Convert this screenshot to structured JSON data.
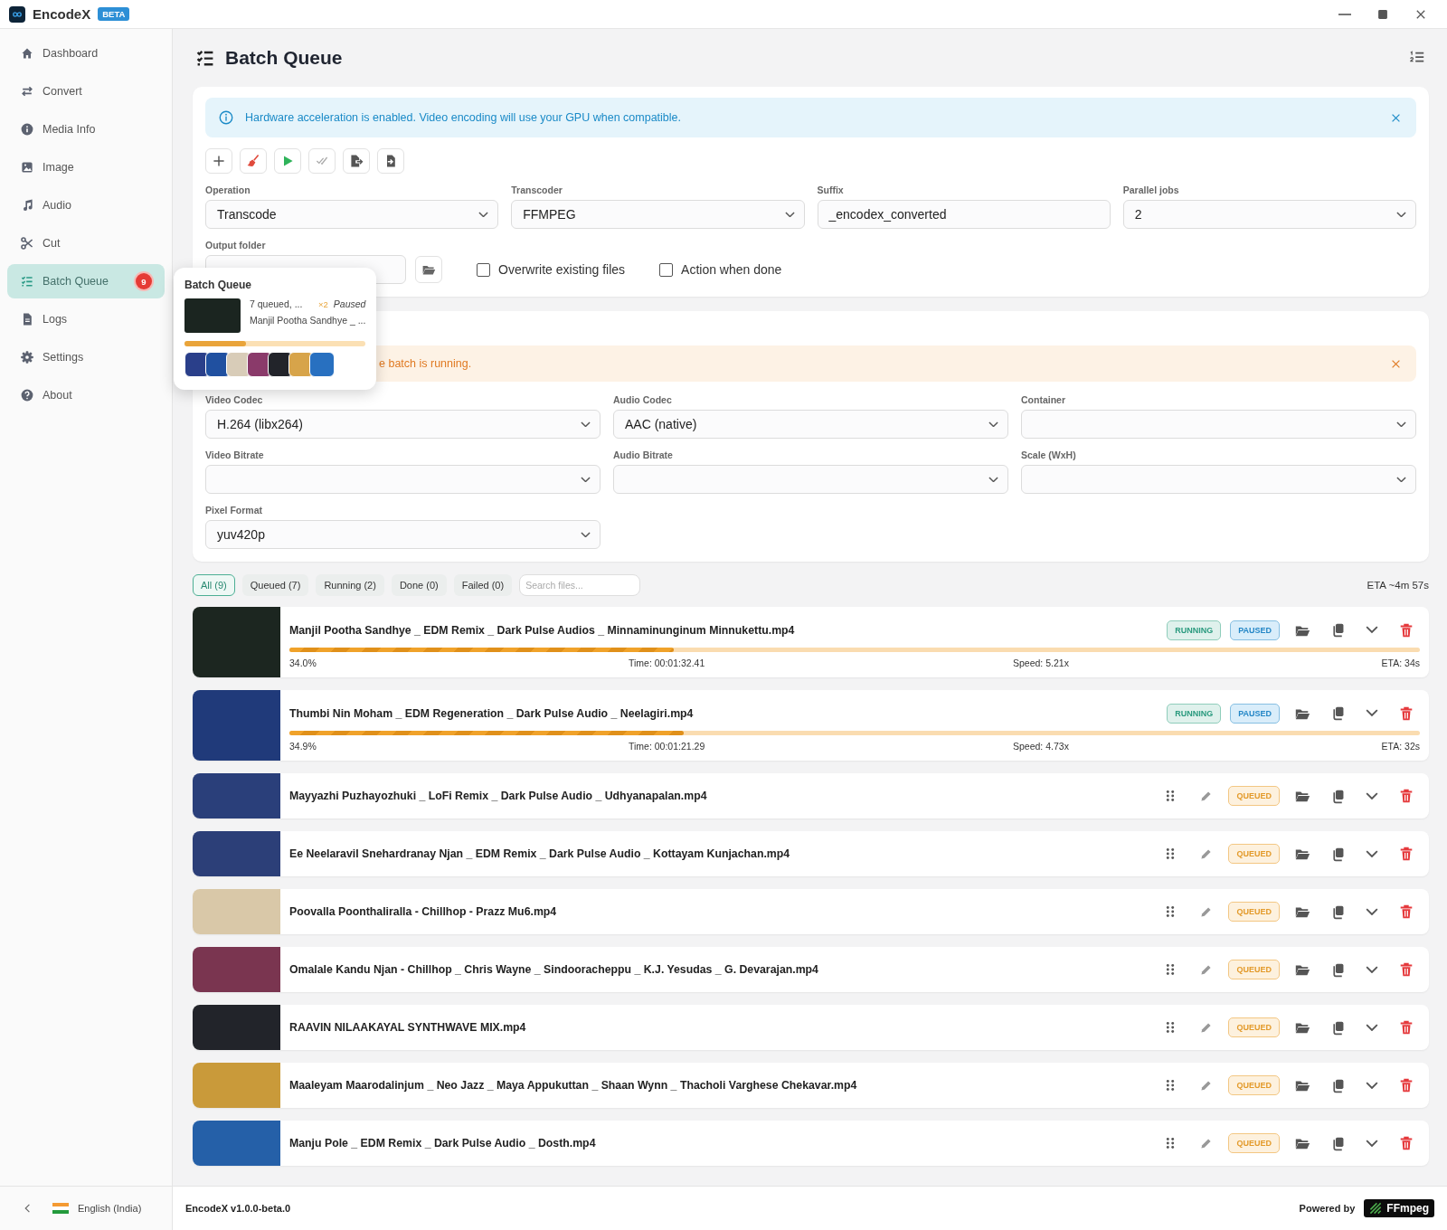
{
  "window": {
    "app_name": "EncodeX",
    "badge": "BETA"
  },
  "sidebar": {
    "items": [
      {
        "label": "Dashboard",
        "selected": false
      },
      {
        "label": "Convert",
        "selected": false
      },
      {
        "label": "Media Info",
        "selected": false
      },
      {
        "label": "Image",
        "selected": false
      },
      {
        "label": "Audio",
        "selected": false
      },
      {
        "label": "Cut",
        "selected": false
      },
      {
        "label": "Batch Queue",
        "selected": true,
        "badge": "9"
      },
      {
        "label": "Logs",
        "selected": false
      },
      {
        "label": "Settings",
        "selected": false
      },
      {
        "label": "About",
        "selected": false
      }
    ],
    "language": "English (India)"
  },
  "popover": {
    "title": "Batch Queue",
    "summary": "7 queued, ...",
    "multiplier": "×2",
    "state": "Paused",
    "current_file": "Manjil Pootha Sandhye _ ...",
    "level": 0.34
  },
  "page": {
    "title": "Batch Queue"
  },
  "info_banner": {
    "text": "Hardware acceleration is enabled. Video encoding will use your GPU when compatible."
  },
  "settings": {
    "fields": [
      {
        "label": "Operation",
        "kind": "select",
        "value": "Transcode"
      },
      {
        "label": "Transcoder",
        "kind": "select",
        "value": "FFMPEG"
      },
      {
        "label": "Suffix",
        "kind": "text",
        "value": "_encodex_converted"
      },
      {
        "label": "Parallel jobs",
        "kind": "select",
        "value": "2"
      }
    ],
    "output_folder_label": "Output folder",
    "checkboxes": [
      {
        "label": "Overwrite existing files",
        "checked": false
      },
      {
        "label": "Action when done",
        "checked": false
      }
    ]
  },
  "warning_banner": {
    "text": "e batch is running."
  },
  "codec_fields": [
    {
      "label": "Video Codec",
      "value": "H.264 (libx264)"
    },
    {
      "label": "Audio Codec",
      "value": "AAC (native)"
    },
    {
      "label": "Container"
    },
    {
      "label": "Video Bitrate"
    },
    {
      "label": "Audio Bitrate"
    },
    {
      "label": "Scale (WxH)"
    },
    {
      "label": "Pixel Format",
      "value": "yuv420p"
    }
  ],
  "filters": [
    {
      "label": "All (9)",
      "selected": true
    },
    {
      "label": "Queued (7)",
      "selected": false
    },
    {
      "label": "Running (2)",
      "selected": false
    },
    {
      "label": "Done (0)",
      "selected": false
    },
    {
      "label": "Failed (0)",
      "selected": false
    }
  ],
  "search": {
    "placeholder": "Search files..."
  },
  "total_eta": "ETA ~4m 57s",
  "jobs": [
    {
      "name": "Manjil Pootha Sandhye _ EDM Remix _ Dark Pulse Audios _ Minnaminunginum Minnukettu.mp4",
      "kind": "running",
      "badges": [
        {
          "label": "RUNNING",
          "kind": "running"
        },
        {
          "label": "PAUSED",
          "kind": "paused"
        }
      ],
      "level": 0.34,
      "percent": "34.0%",
      "time": "Time: 00:01:32.41",
      "speed": "Speed: 5.21x",
      "eta": "ETA: 34s"
    },
    {
      "name": "Thumbi Nin Moham _ EDM Regeneration _ Dark Pulse Audio _ Neelagiri.mp4",
      "kind": "running",
      "badges": [
        {
          "label": "RUNNING",
          "kind": "running"
        },
        {
          "label": "PAUSED",
          "kind": "paused"
        }
      ],
      "level": 0.349,
      "percent": "34.9%",
      "time": "Time: 00:01:21.29",
      "speed": "Speed: 4.73x",
      "eta": "ETA: 32s"
    },
    {
      "name": "Mayyazhi Puzhayozhuki _ LoFi Remix _ Dark Pulse Audio _ Udhyanapalan.mp4",
      "kind": "queued",
      "badges": [
        {
          "label": "QUEUED",
          "kind": "queued"
        }
      ]
    },
    {
      "name": "Ee Neelaravil Snehardranay Njan _ EDM Remix _ Dark Pulse Audio _ Kottayam Kunjachan.mp4",
      "kind": "queued",
      "badges": [
        {
          "label": "QUEUED",
          "kind": "queued"
        }
      ]
    },
    {
      "name": "Poovalla Poonthaliralla - Chillhop - Prazz Mu6.mp4",
      "kind": "queued",
      "badges": [
        {
          "label": "QUEUED",
          "kind": "queued"
        }
      ]
    },
    {
      "name": "Omalale Kandu Njan - Chillhop _ Chris Wayne _ Sindooracheppu _ K.J. Yesudas _ G. Devarajan.mp4",
      "kind": "queued",
      "badges": [
        {
          "label": "QUEUED",
          "kind": "queued"
        }
      ]
    },
    {
      "name": "RAAVIN NILAAKAYAL SYNTHWAVE MIX.mp4",
      "kind": "queued",
      "badges": [
        {
          "label": "QUEUED",
          "kind": "queued"
        }
      ]
    },
    {
      "name": "Maaleyam Maarodalinjum _ Neo Jazz _ Maya Appukuttan _ Shaan Wynn _ Thacholi Varghese Chekavar.mp4",
      "kind": "queued",
      "badges": [
        {
          "label": "QUEUED",
          "kind": "queued"
        }
      ]
    },
    {
      "name": "Manju Pole _ EDM Remix _ Dark Pulse Audio _ Dosth.mp4",
      "kind": "queued",
      "badges": [
        {
          "label": "QUEUED",
          "kind": "queued"
        }
      ]
    }
  ],
  "footer": {
    "version": "EncodeX v1.0.0-beta.0",
    "powered_by": "Powered by",
    "logo_text": "FFmpeg"
  }
}
